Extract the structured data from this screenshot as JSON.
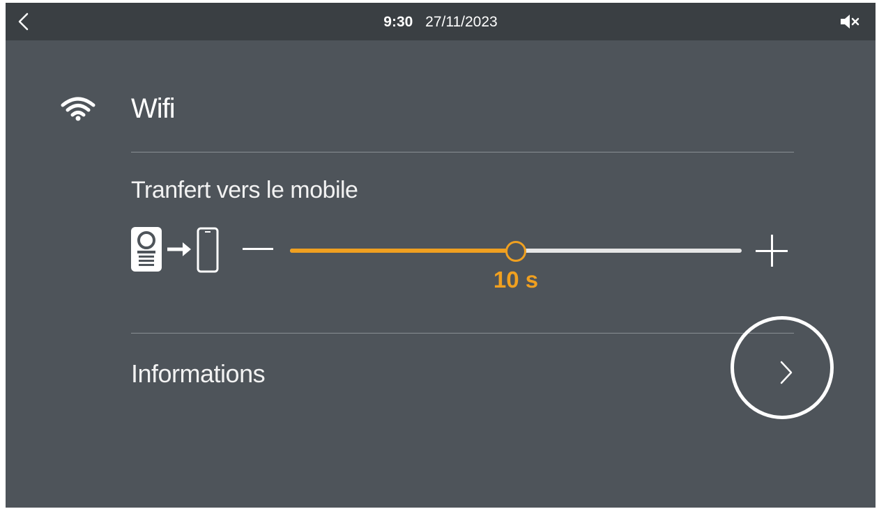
{
  "statusbar": {
    "time": "9:30",
    "date": "27/11/2023",
    "back_icon": "chevron-left-icon",
    "mute_icon": "speaker-muted-icon"
  },
  "wifi": {
    "icon": "wifi-icon",
    "label": "Wifi"
  },
  "transfer": {
    "label": "Tranfert vers le mobile",
    "icon": "doorphone-to-mobile-icon",
    "slider": {
      "value_label": "10 s",
      "fraction": 0.5
    }
  },
  "informations": {
    "label": "Informations",
    "chevron_icon": "chevron-right-icon"
  },
  "colors": {
    "background": "#4e545a",
    "topbar": "#3a3f43",
    "accent": "#f0a020",
    "track": "#e6e6e6"
  }
}
